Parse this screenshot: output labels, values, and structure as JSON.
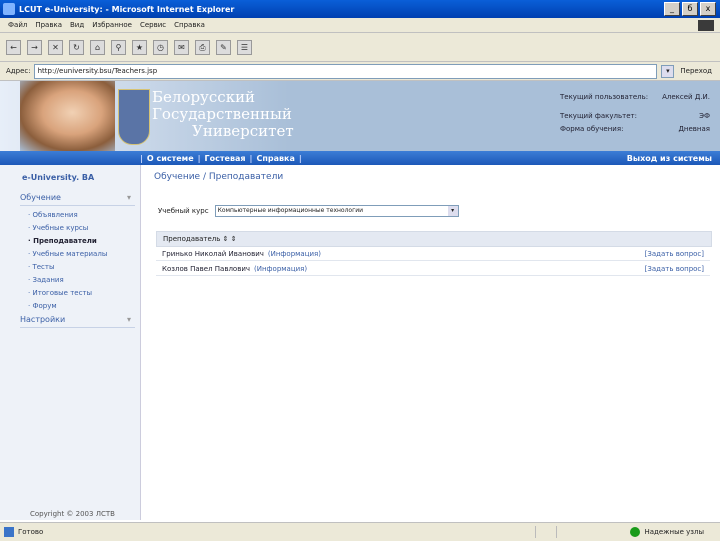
{
  "window": {
    "title": "LCUT e-University: - Microsoft Internet Explorer",
    "btn_min": "_",
    "btn_max": "б",
    "btn_close": "x"
  },
  "menu": [
    "Файл",
    "Правка",
    "Вид",
    "Избранное",
    "Сервис",
    "Справка"
  ],
  "address": {
    "label": "Адрес:",
    "url": "http://euniversity.bsu/Teachers.jsp",
    "go": "Переход"
  },
  "banner": {
    "line1": "Белорусский",
    "line2": "Государственный",
    "line3": "Университет",
    "user_label": "Текущий пользователь:",
    "user_value": "Алексей Д.И.",
    "faculty_label": "Текущий факультет:",
    "faculty_value": "ЭФ",
    "form_label": "Форма обучения:",
    "form_value": "Дневная"
  },
  "nav": {
    "about": "О системе",
    "guestbook": "Гостевая",
    "help": "Справка",
    "logout": "Выход из системы",
    "sep": "|"
  },
  "sidebar": {
    "logo": "e-University. ВА",
    "section1": "Обучение",
    "items": [
      "Объявления",
      "Учебные курсы",
      "Преподаватели",
      "Учебные материалы",
      "Тесты",
      "Задания",
      "Итоговые тесты",
      "Форум"
    ],
    "section2": "Настройки",
    "copyright": "Copyright © 2003 ЛСTВ"
  },
  "main": {
    "breadcrumb": "Обучение / Преподаватели",
    "course_label": "Учебный курс",
    "course_value": "Компьютерные информационные технологии",
    "table_header": "Преподаватель ⇕ ⇕",
    "rows": [
      {
        "name": "Гринько Николай Иванович",
        "info": "(Информация)",
        "ask": "[Задать вопрос]"
      },
      {
        "name": "Козлов Павел Павлович",
        "info": "(Информация)",
        "ask": "[Задать вопрос]"
      }
    ]
  },
  "status": {
    "left": "Готово",
    "right": "Надежные узлы"
  }
}
